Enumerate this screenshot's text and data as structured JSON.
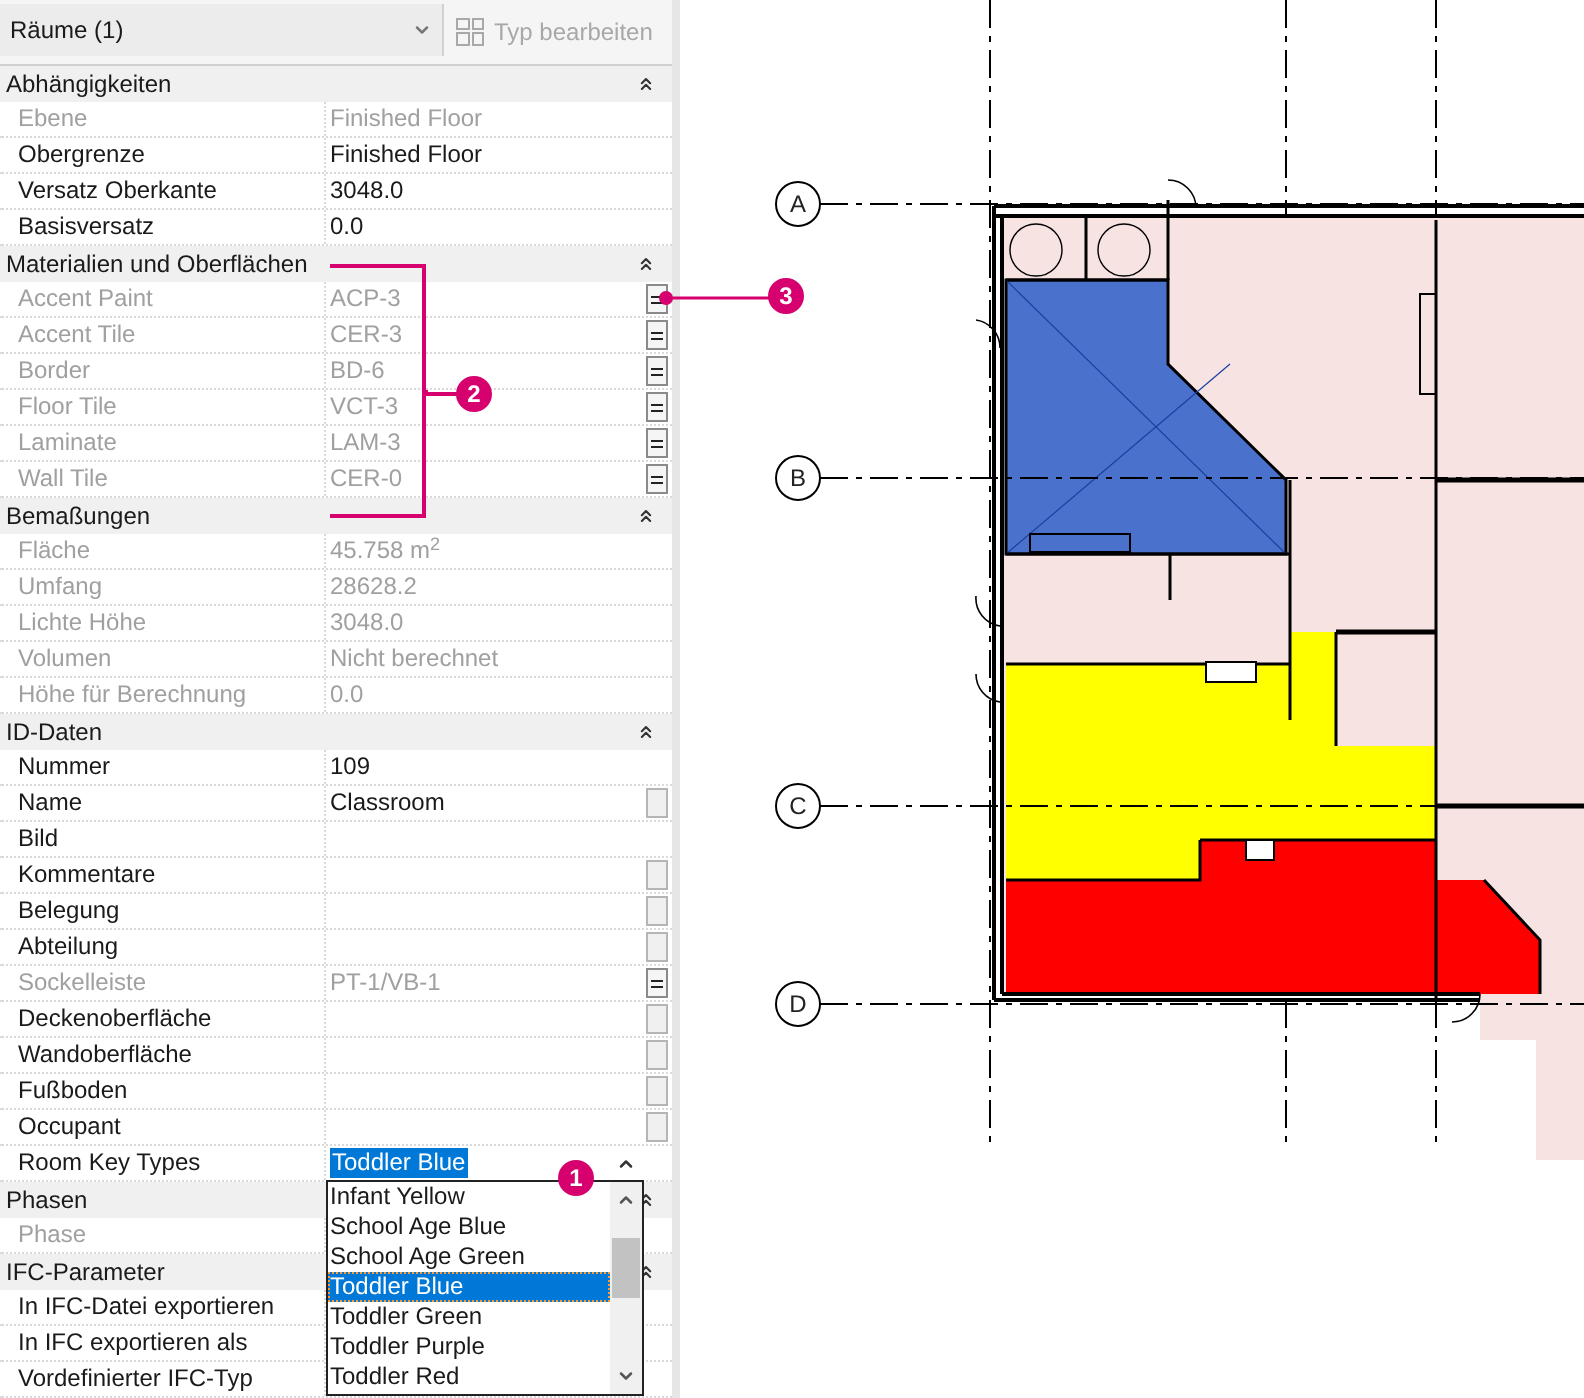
{
  "type_selector": {
    "value": "Räume (1)"
  },
  "edit_type_button": {
    "label": "Typ bearbeiten",
    "disabled": true
  },
  "sections": [
    {
      "title": "Abhängigkeiten",
      "expanded": true,
      "rows": [
        {
          "label": "Ebene",
          "value": "Finished Floor",
          "disabled": true,
          "kind": "text"
        },
        {
          "label": "Obergrenze",
          "value": "Finished Floor",
          "disabled": false,
          "kind": "text"
        },
        {
          "label": "Versatz Oberkante",
          "value": "3048.0",
          "disabled": false,
          "kind": "text"
        },
        {
          "label": "Basisversatz",
          "value": "0.0",
          "disabled": false,
          "kind": "text"
        }
      ]
    },
    {
      "title": "Materialien und Oberflächen",
      "expanded": true,
      "rows": [
        {
          "label": "Accent Paint",
          "value": "ACP-3",
          "disabled": true,
          "kind": "browse"
        },
        {
          "label": "Accent Tile",
          "value": "CER-3",
          "disabled": true,
          "kind": "browse"
        },
        {
          "label": "Border",
          "value": "BD-6",
          "disabled": true,
          "kind": "browse"
        },
        {
          "label": "Floor Tile",
          "value": "VCT-3",
          "disabled": true,
          "kind": "browse"
        },
        {
          "label": "Laminate",
          "value": "LAM-3",
          "disabled": true,
          "kind": "browse"
        },
        {
          "label": "Wall Tile",
          "value": "CER-0",
          "disabled": true,
          "kind": "browse"
        }
      ]
    },
    {
      "title": "Bemaßungen",
      "expanded": true,
      "rows": [
        {
          "label": "Fläche",
          "value": "45.758 m$^{2}$",
          "disabled": true,
          "kind": "text"
        },
        {
          "label": "Umfang",
          "value": "28628.2",
          "disabled": true,
          "kind": "text"
        },
        {
          "label": "Lichte Höhe",
          "value": "3048.0",
          "disabled": true,
          "kind": "text"
        },
        {
          "label": "Volumen",
          "value": "Nicht berechnet",
          "disabled": true,
          "kind": "text"
        },
        {
          "label": "Höhe für Berechnung",
          "value": "0.0",
          "disabled": true,
          "kind": "text"
        }
      ]
    },
    {
      "title": "ID-Daten",
      "expanded": true,
      "rows": [
        {
          "label": "Nummer",
          "value": "109",
          "disabled": false,
          "kind": "text"
        },
        {
          "label": "Name",
          "value": "Classroom",
          "disabled": false,
          "kind": "edit"
        },
        {
          "label": "Bild",
          "disabled": false,
          "kind": "text"
        },
        {
          "label": "Kommentare",
          "disabled": false,
          "kind": "edit"
        },
        {
          "label": "Belegung",
          "disabled": false,
          "kind": "edit"
        },
        {
          "label": "Abteilung",
          "disabled": false,
          "kind": "edit"
        },
        {
          "label": "Sockelleiste",
          "value": "PT-1/VB-1",
          "disabled": true,
          "kind": "browse"
        },
        {
          "label": "Deckenoberfläche",
          "disabled": false,
          "kind": "edit"
        },
        {
          "label": "Wandoberfläche",
          "disabled": false,
          "kind": "edit"
        },
        {
          "label": "Fußboden",
          "disabled": false,
          "kind": "edit"
        },
        {
          "label": "Occupant",
          "disabled": false,
          "kind": "edit"
        },
        {
          "label": "Room Key Types",
          "value": "Toddler Blue",
          "disabled": false,
          "kind": "select"
        }
      ]
    },
    {
      "title": "Phasen",
      "expanded": true,
      "rows": [
        {
          "label": "Phase",
          "disabled": true,
          "kind": "text"
        }
      ]
    },
    {
      "title": "IFC-Parameter",
      "expanded": true,
      "rows": [
        {
          "label": "In IFC-Datei exportieren",
          "disabled": false,
          "kind": "text"
        },
        {
          "label": "In IFC exportieren als",
          "disabled": false,
          "kind": "text"
        },
        {
          "label": "Vordefinierter IFC-Typ",
          "disabled": false,
          "kind": "text"
        }
      ]
    }
  ],
  "dropdown": {
    "items": [
      {
        "label": "Infant Yellow",
        "selected": false
      },
      {
        "label": "School Age Blue",
        "selected": false
      },
      {
        "label": "School Age Green",
        "selected": false
      },
      {
        "label": "Toddler Blue",
        "selected": true
      },
      {
        "label": "Toddler Green",
        "selected": false
      },
      {
        "label": "Toddler Purple",
        "selected": false
      },
      {
        "label": "Toddler Red",
        "selected": false
      }
    ]
  },
  "callouts": [
    "1",
    "2",
    "3"
  ],
  "grid_lines": [
    "A",
    "B",
    "C",
    "D"
  ]
}
